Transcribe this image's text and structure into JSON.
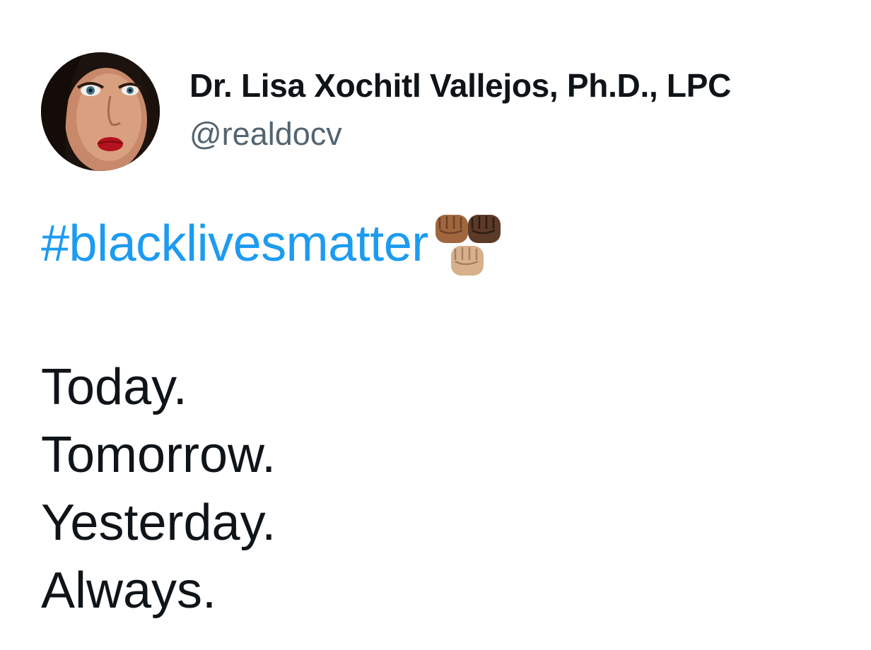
{
  "tweet": {
    "author": {
      "display_name": "Dr. Lisa Xochitl Vallejos, Ph.D., LPC",
      "handle": "@realdocv"
    },
    "hashtag": "#blacklivesmatter",
    "emoji_icons": [
      "raised-fist-medium-dark-icon",
      "raised-fist-dark-icon",
      "raised-fist-medium-light-icon"
    ],
    "lines": [
      "Today.",
      "Tomorrow.",
      "Yesterday.",
      "Always."
    ]
  },
  "colors": {
    "name": "#0f1419",
    "handle": "#536471",
    "link": "#1d9bf0",
    "text": "#0f1419"
  }
}
